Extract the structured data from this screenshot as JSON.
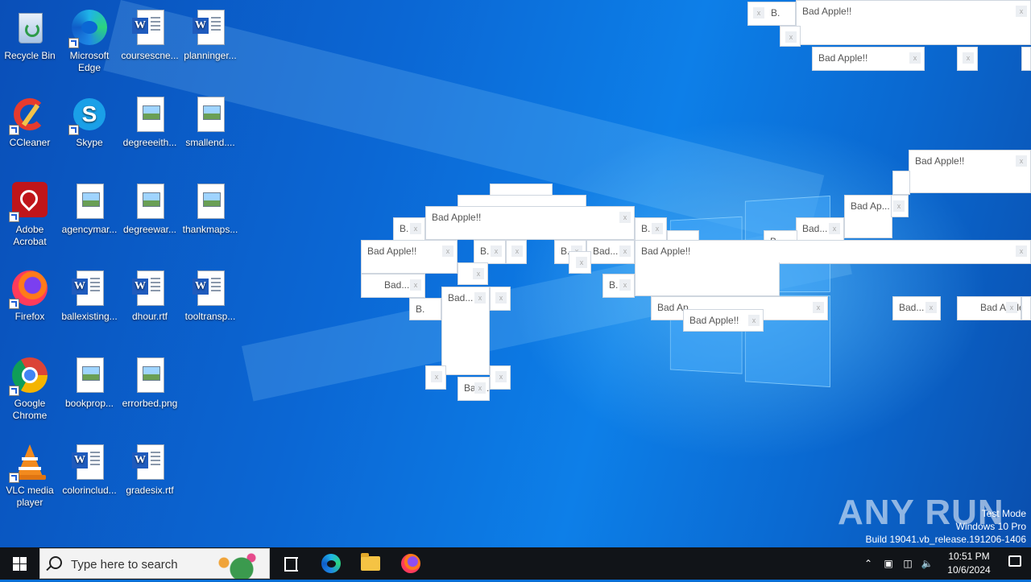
{
  "desktop_icons": [
    {
      "label": "Recycle Bin",
      "icon": "recycle-bin-icon"
    },
    {
      "label": "Microsoft Edge",
      "icon": "edge-icon"
    },
    {
      "label": "coursescne...",
      "icon": "word-doc-icon"
    },
    {
      "label": "planninger...",
      "icon": "word-doc-icon"
    },
    {
      "label": "CCleaner",
      "icon": "ccleaner-icon"
    },
    {
      "label": "Skype",
      "icon": "skype-icon"
    },
    {
      "label": "degreeeith...",
      "icon": "image-file-icon"
    },
    {
      "label": "smallend....",
      "icon": "image-file-icon"
    },
    {
      "label": "Adobe Acrobat",
      "icon": "acrobat-icon"
    },
    {
      "label": "agencymar...",
      "icon": "image-file-icon"
    },
    {
      "label": "degreewar...",
      "icon": "image-file-icon"
    },
    {
      "label": "thankmaps...",
      "icon": "image-file-icon"
    },
    {
      "label": "Firefox",
      "icon": "firefox-icon"
    },
    {
      "label": "ballexisting...",
      "icon": "word-doc-icon"
    },
    {
      "label": "dhour.rtf",
      "icon": "word-doc-icon"
    },
    {
      "label": "tooltransp...",
      "icon": "word-doc-icon"
    },
    {
      "label": "Google Chrome",
      "icon": "chrome-icon"
    },
    {
      "label": "bookprop...",
      "icon": "image-file-icon"
    },
    {
      "label": "errorbed.png",
      "icon": "image-file-icon"
    },
    {
      "label": "VLC media player",
      "icon": "vlc-icon"
    },
    {
      "label": "colorinclud...",
      "icon": "word-doc-icon"
    },
    {
      "label": "gradesix.rtf",
      "icon": "word-doc-icon"
    }
  ],
  "popup_windows": {
    "full_title": "Bad Apple!!",
    "titles": [
      "B.",
      "Bad Apple!!",
      "Bad Apple!!",
      "Bad Apple!!",
      "Bad Ap...",
      "Bad...",
      "B.",
      "Bad Apple!!",
      "Bad Apple!!",
      "Bad...",
      "B.",
      "B.",
      "Bad...",
      "B.",
      "Bad...",
      "Bad...",
      "B.",
      "Bad Apple!!",
      "Bad...",
      "Bad...",
      "Bad Apple!!",
      "B.",
      "Bad...",
      "B.",
      "Bad Ap",
      "Bad Apple!!"
    ]
  },
  "watermark": {
    "brand": "ANY RUN",
    "line1": "Test Mode",
    "line2": "Windows 10 Pro",
    "line3": "Build 19041.vb_release.191206-1406"
  },
  "taskbar": {
    "search_placeholder": "Type here to search",
    "pinned": [
      "task-view",
      "edge",
      "file-explorer",
      "firefox"
    ],
    "time": "10:51 PM",
    "date": "10/6/2024"
  },
  "colors": {
    "taskbar": "#111418",
    "desktop_accent": "#0d7fe8"
  }
}
